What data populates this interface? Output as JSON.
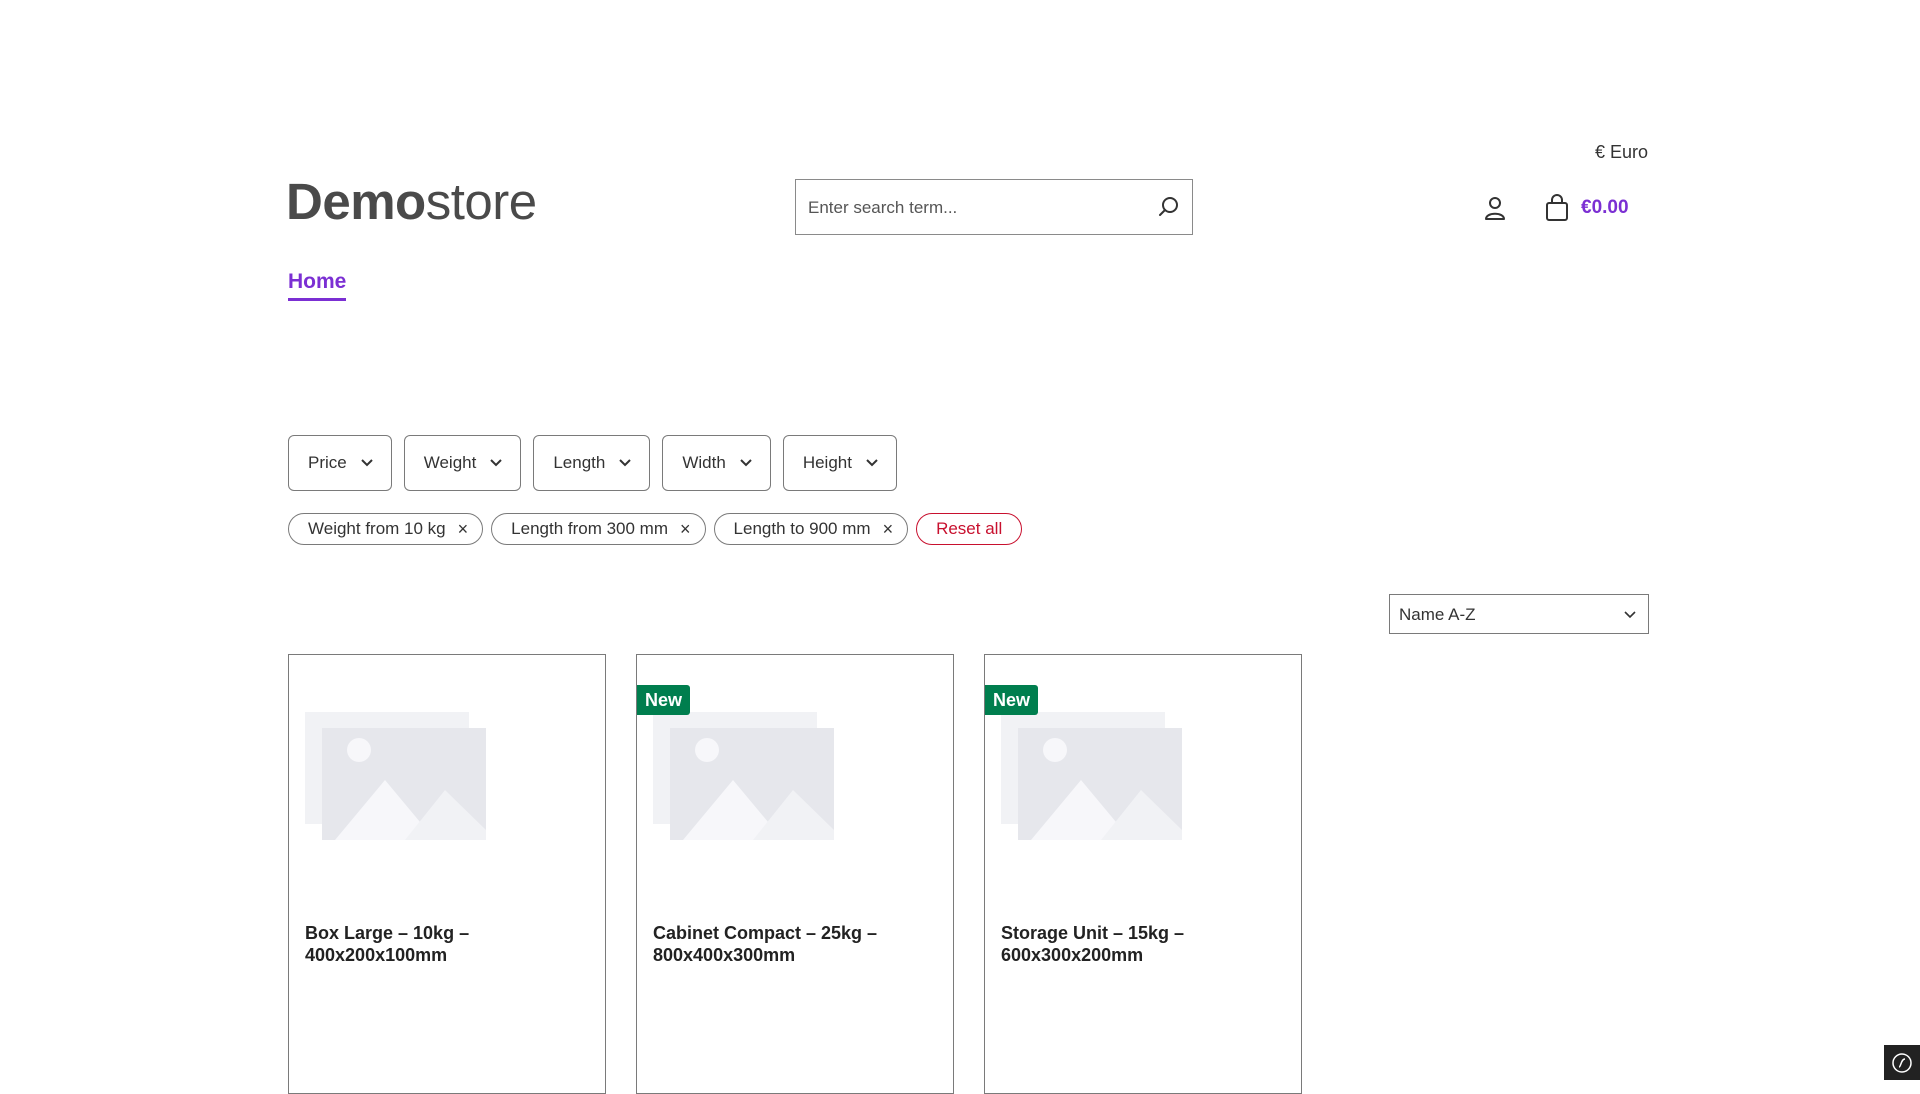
{
  "header": {
    "currency": "€ Euro",
    "logo": {
      "bold": "Demo",
      "light": "store"
    },
    "search": {
      "placeholder": "Enter search term..."
    },
    "cart_total": "€0.00"
  },
  "nav": {
    "home": "Home"
  },
  "filters": [
    "Price",
    "Weight",
    "Length",
    "Width",
    "Height"
  ],
  "active_filters": [
    "Weight from 10 kg",
    "Length from 300 mm",
    "Length to 900 mm"
  ],
  "reset_all": "Reset all",
  "sort": {
    "selected": "Name A-Z"
  },
  "products": [
    {
      "title": "Box Large – 10kg – 400x200x100mm",
      "badge": ""
    },
    {
      "title": "Cabinet Compact – 25kg – 800x400x300mm",
      "badge": "New"
    },
    {
      "title": "Storage Unit – 15kg – 600x300x200mm",
      "badge": "New"
    }
  ],
  "colors": {
    "accent": "#7b2fd3",
    "badge": "#007e4e",
    "reset": "#c8102e"
  }
}
